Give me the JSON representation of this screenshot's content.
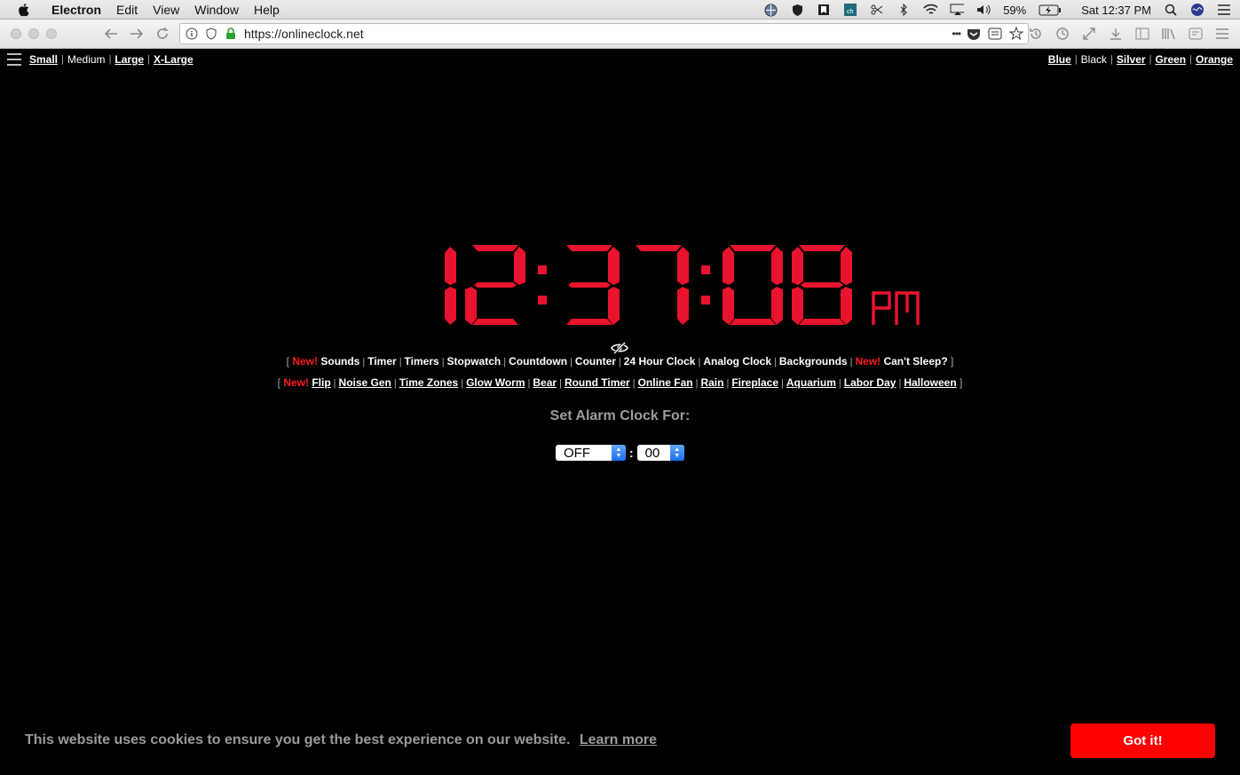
{
  "os_menubar": {
    "app_name": "Electron",
    "menus": [
      "Edit",
      "View",
      "Window",
      "Help"
    ],
    "battery": "59%",
    "clock": "Sat 12:37 PM"
  },
  "browser": {
    "url": "https://onlineclock.net",
    "more_label": "•••"
  },
  "size_bar": {
    "items": [
      {
        "label": "Small",
        "active": false
      },
      {
        "label": "Medium",
        "active": true
      },
      {
        "label": "Large",
        "active": false
      },
      {
        "label": "X-Large",
        "active": false
      }
    ]
  },
  "color_bar": {
    "items": [
      {
        "label": "Blue",
        "active": false
      },
      {
        "label": "Black",
        "active": true
      },
      {
        "label": "Silver",
        "active": false
      },
      {
        "label": "Green",
        "active": false
      },
      {
        "label": "Orange",
        "active": false
      }
    ]
  },
  "clock": {
    "time": "12:37:08",
    "period": "PM",
    "color": "#e8132d"
  },
  "links_row1": {
    "new_label": "New!",
    "items": [
      "Sounds",
      "Timer",
      "Timers",
      "Stopwatch",
      "Countdown",
      "Counter",
      "24 Hour Clock",
      "Analog Clock",
      "Backgrounds"
    ],
    "new_label_2": "New!",
    "last_item": "Can't Sleep?",
    "open_bracket": "[",
    "close_bracket": "]"
  },
  "links_row2": {
    "new_label": "New!",
    "items": [
      "Flip",
      "Noise Gen",
      "Time Zones",
      "Glow Worm",
      "Bear",
      "Round Timer",
      "Online Fan",
      "Rain",
      "Fireplace",
      "Aquarium",
      "Labor Day",
      "Halloween"
    ],
    "open_bracket": "[",
    "close_bracket": "]"
  },
  "alarm": {
    "label": "Set Alarm Clock For:",
    "hour_value": "OFF",
    "separator": ":",
    "minute_value": "00"
  },
  "cookie": {
    "message": "This website uses cookies to ensure you get the best experience on our website.",
    "learn_more": "Learn more",
    "button": "Got it!"
  }
}
